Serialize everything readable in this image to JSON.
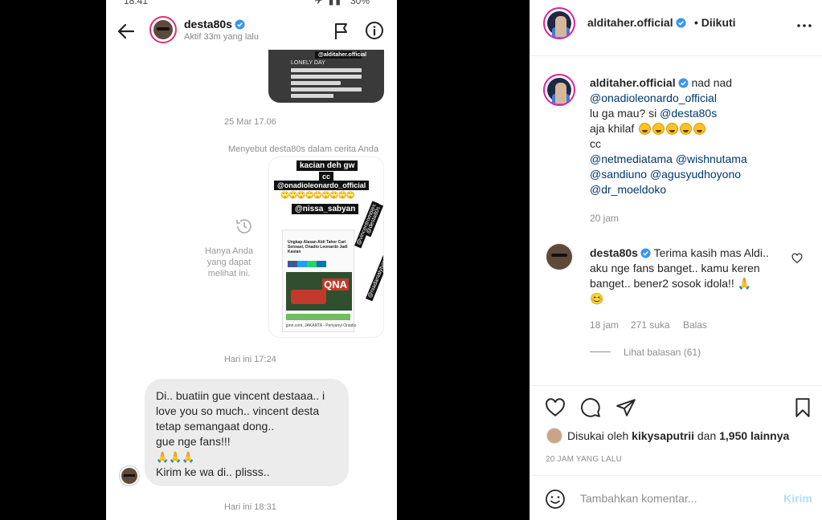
{
  "screenshot": {
    "status_time": "18:41",
    "battery": "30%",
    "dm": {
      "username": "desta80s",
      "active_status": "Aktif 33m yang lalu",
      "story_top_tag": "@alditaher.official",
      "story_top_text": "LONELY DAY",
      "timestamp_1": "25 Mar 17.06",
      "mention_note": "Menyebut desta80s dalam cerita Anda",
      "only_you_note": "Hanya Anda yang dapat melihat ini.",
      "story_tags": {
        "t1": "kacian deh gw",
        "t2": "cc",
        "t3": "@onadioleonardo_official",
        "t4": "@nissa_sabyan",
        "r1": "@vincentrompies",
        "r2": "@desta80s",
        "r3": "@niadanialytvnw"
      },
      "story_emojis": "🙄🙄🙄🙄🙄🙄🙄🙄🙄",
      "article_title": "Ungkap Alasan Aldi Taher Cari Sensasi, Onadio Leonardo Jadi Kasian",
      "article_badge": "QNA",
      "article_footer": "jpnn.com, JAKARTA - Penyanyi Onadio",
      "timestamp_2": "Hari ini 17:24",
      "message_lines": [
        "Di.. buatiin gue vincent destaaa.. i",
        "love you so much.. vincent desta",
        "tetap semangaat dong..",
        "gue nge fans!!!",
        "🙏🙏🙏",
        "Kirim ke wa di.. plisss.."
      ],
      "timestamp_3": "Hari ini 18:31"
    }
  },
  "post": {
    "author": "alditaher.official",
    "follow_status": "• Diikuti",
    "more_icon": "more-horizontal-icon",
    "caption": {
      "username": "alditaher.official",
      "line1_text": "nad nad",
      "line2_mention": "@onadioleonardo_official",
      "line3_text": "lu ga mau? si ",
      "line3_mention": "@desta80s",
      "line4_text": "aja khilaf",
      "line5_text": "cc",
      "line6_m1": "@netmediatama",
      "line6_m2": "@wishnutama",
      "line7_m1": "@sandiuno",
      "line7_m2": "@agusyudhoyono",
      "line8_m1": "@dr_moeldoko",
      "time": "20 jam"
    },
    "comment": {
      "username": "desta80s",
      "line1": "Terima kasih mas Aldi..",
      "line2": "aku nge fans banget.. kamu keren",
      "line3": "banget.. bener2 sosok idola!! 🙏",
      "line4": "😊",
      "time": "18 jam",
      "likes": "271 suka",
      "reply": "Balas",
      "view_replies": "Lihat balasan (61)"
    },
    "likes": {
      "prefix": "Disukai oleh ",
      "user": "kikysaputrii",
      "middle": " dan ",
      "count": "1,950 lainnya"
    },
    "date": "20 JAM YANG LALU",
    "add_comment": {
      "placeholder": "Tambahkan komentar...",
      "post_label": "Kirim"
    }
  },
  "colors": {
    "verified": "#3897f0",
    "link": "#00376b",
    "story_ring": "#d6249f",
    "post_button_disabled": "#b2dffc",
    "bubble": "#ececec"
  }
}
